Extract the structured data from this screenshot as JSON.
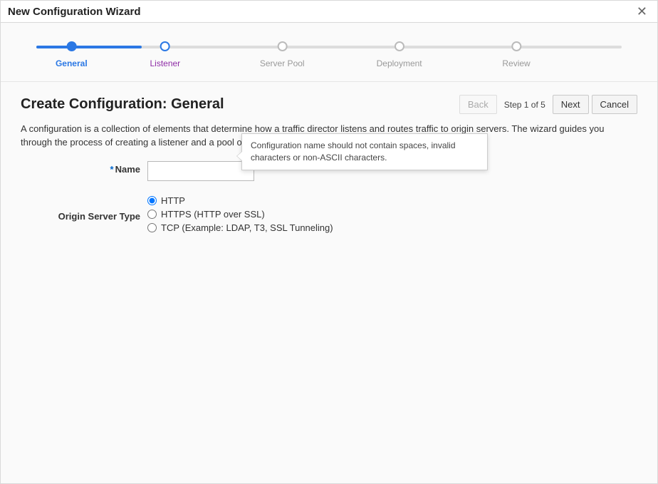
{
  "dialog": {
    "title": "New Configuration Wizard"
  },
  "wizard": {
    "steps": [
      {
        "label": "General",
        "state": "done"
      },
      {
        "label": "Listener",
        "state": "active"
      },
      {
        "label": "Server Pool",
        "state": "pending"
      },
      {
        "label": "Deployment",
        "state": "pending"
      },
      {
        "label": "Review",
        "state": "pending"
      }
    ]
  },
  "page": {
    "heading": "Create Configuration: General",
    "description": "A configuration is a collection of elements that determine how a traffic director listens and routes traffic to origin servers. The wizard guides you through the process of creating a listener and a pool of origin servers."
  },
  "nav": {
    "back": "Back",
    "stepIndicator": "Step 1 of 5",
    "next": "Next",
    "cancel": "Cancel"
  },
  "form": {
    "nameLabel": "Name",
    "nameValue": "",
    "originTypeLabel": "Origin Server Type",
    "originOptions": [
      {
        "value": "http",
        "label": "HTTP"
      },
      {
        "value": "https",
        "label": "HTTPS (HTTP over SSL)"
      },
      {
        "value": "tcp",
        "label": "TCP (Example: LDAP, T3, SSL Tunneling)"
      }
    ],
    "originSelected": "http"
  },
  "tooltip": {
    "text": "Configuration name should not contain spaces, invalid characters or non-ASCII characters."
  }
}
